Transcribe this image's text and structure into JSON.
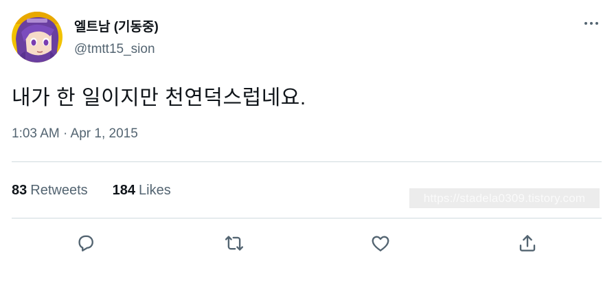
{
  "author": {
    "display_name": "엘트남 (기동중)",
    "handle": "@tmtt15_sion",
    "avatar_icon": "anime-character-avatar"
  },
  "tweet": {
    "text": "내가 한 일이지만 천연덕스럽네요.",
    "timestamp": "1:03 AM · Apr 1, 2015"
  },
  "stats": {
    "retweets_count": "83",
    "retweets_label": "Retweets",
    "likes_count": "184",
    "likes_label": "Likes"
  },
  "watermark": {
    "text": "https://stadela0309.tistory.com"
  },
  "actions": {
    "reply_icon": "reply-icon",
    "retweet_icon": "retweet-icon",
    "like_icon": "heart-icon",
    "share_icon": "share-icon"
  },
  "colors": {
    "primary_text": "#0f1419",
    "secondary_text": "#536471",
    "divider": "#cfd9de",
    "avatar_purple": "#6a3fa0",
    "avatar_yellow": "#f5c400"
  }
}
